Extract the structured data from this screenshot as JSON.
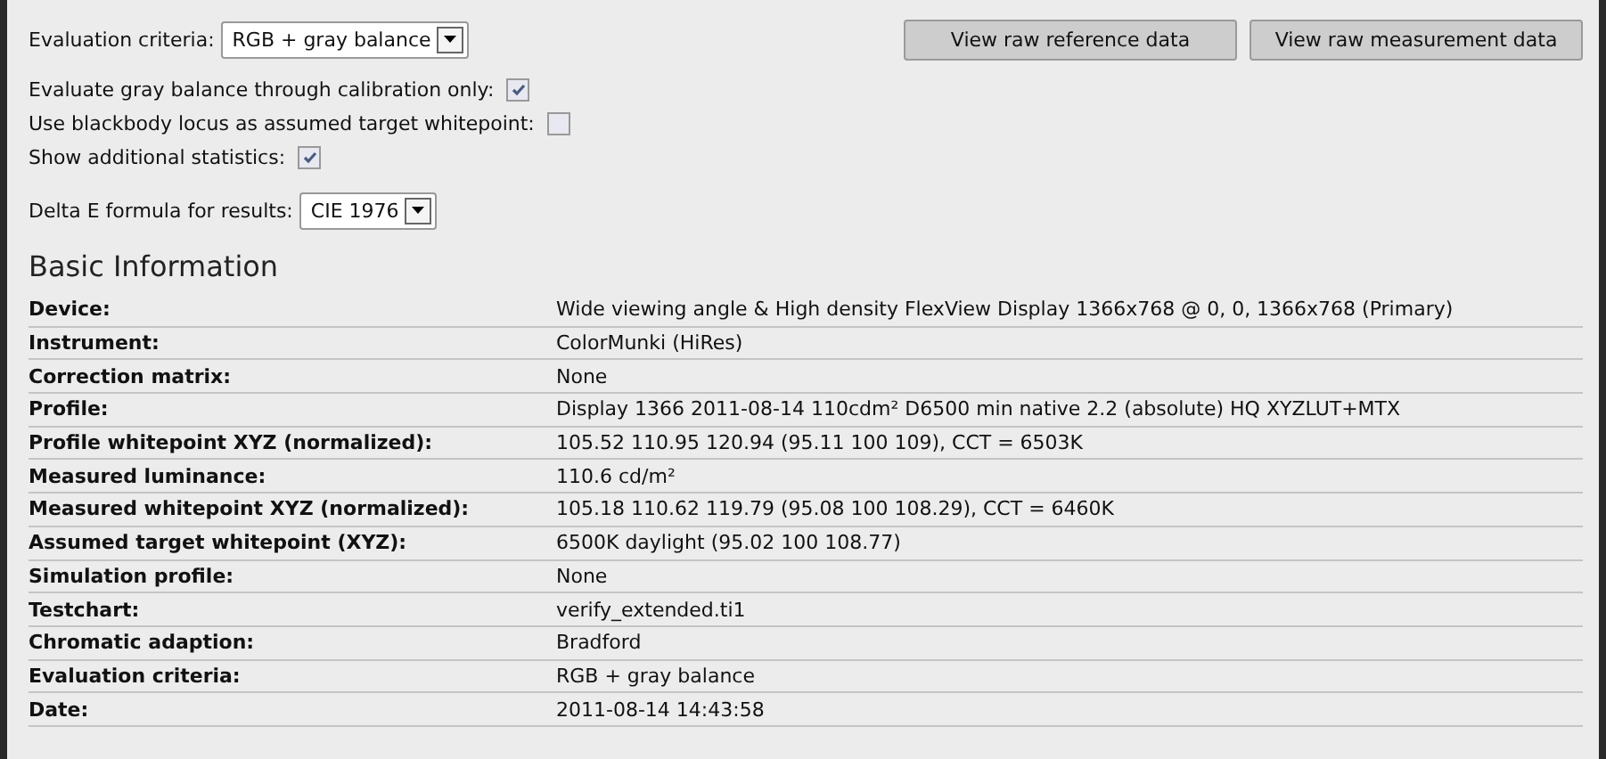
{
  "evaluation_criteria": {
    "label": "Evaluation criteria:",
    "value": "RGB + gray balance"
  },
  "buttons": [
    "View raw reference data",
    "View raw measurement data"
  ],
  "options": [
    {
      "label": "Evaluate gray balance through calibration only:",
      "checked": true
    },
    {
      "label": "Use blackbody locus as assumed target whitepoint:",
      "checked": false
    },
    {
      "label": "Show additional statistics:",
      "checked": true
    }
  ],
  "delta_e_formula": {
    "label": "Delta E formula for results:",
    "value": "CIE 1976"
  },
  "section_title": "Basic Information",
  "info_rows": [
    {
      "label": "Device:",
      "value": "Wide viewing angle & High density FlexView Display 1366x768 @ 0, 0, 1366x768 (Primary)"
    },
    {
      "label": "Instrument:",
      "value": "ColorMunki (HiRes)"
    },
    {
      "label": "Correction matrix:",
      "value": "None"
    },
    {
      "label": "Profile:",
      "value": "Display 1366 2011-08-14 110cdm² D6500 min native 2.2 (absolute) HQ XYZLUT+MTX"
    },
    {
      "label": "Profile whitepoint XYZ (normalized):",
      "value": "105.52 110.95 120.94 (95.11 100 109), CCT = 6503K"
    },
    {
      "label": "Measured luminance:",
      "value": "110.6 cd/m²"
    },
    {
      "label": "Measured whitepoint XYZ (normalized):",
      "value": "105.18 110.62 119.79 (95.08 100 108.29), CCT = 6460K"
    },
    {
      "label": "Assumed target whitepoint (XYZ):",
      "value": "6500K daylight (95.02 100 108.77)"
    },
    {
      "label": "Simulation profile:",
      "value": "None"
    },
    {
      "label": "Testchart:",
      "value": "verify_extended.ti1"
    },
    {
      "label": "Chromatic adaption:",
      "value": "Bradford"
    },
    {
      "label": "Evaluation criteria:",
      "value": "RGB + gray balance"
    },
    {
      "label": "Date:",
      "value": "2011-08-14 14:43:58"
    }
  ]
}
